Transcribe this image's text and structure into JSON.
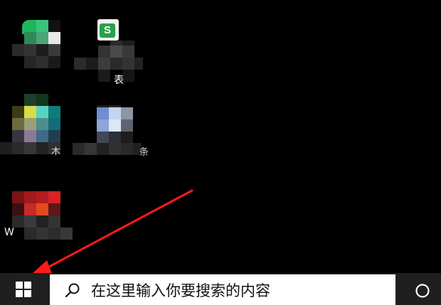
{
  "desktop": {
    "icons": [
      {
        "name": "desktop-icon-1",
        "label": ""
      },
      {
        "name": "desktop-icon-wps-spreadsheet",
        "label": "表"
      },
      {
        "name": "desktop-icon-3",
        "label": ""
      },
      {
        "name": "desktop-icon-4",
        "label": ""
      },
      {
        "name": "desktop-icon-5",
        "label": "W"
      }
    ],
    "partial_labels": {
      "icon3": "木",
      "icon4": "条"
    }
  },
  "taskbar": {
    "start_icon": "windows-logo-icon",
    "search_icon": "search-icon",
    "search_placeholder": "在这里输入你要搜索的内容",
    "cortana_icon": "cortana-circle-icon"
  },
  "annotation": {
    "arrow_color": "#ff1a1a"
  }
}
